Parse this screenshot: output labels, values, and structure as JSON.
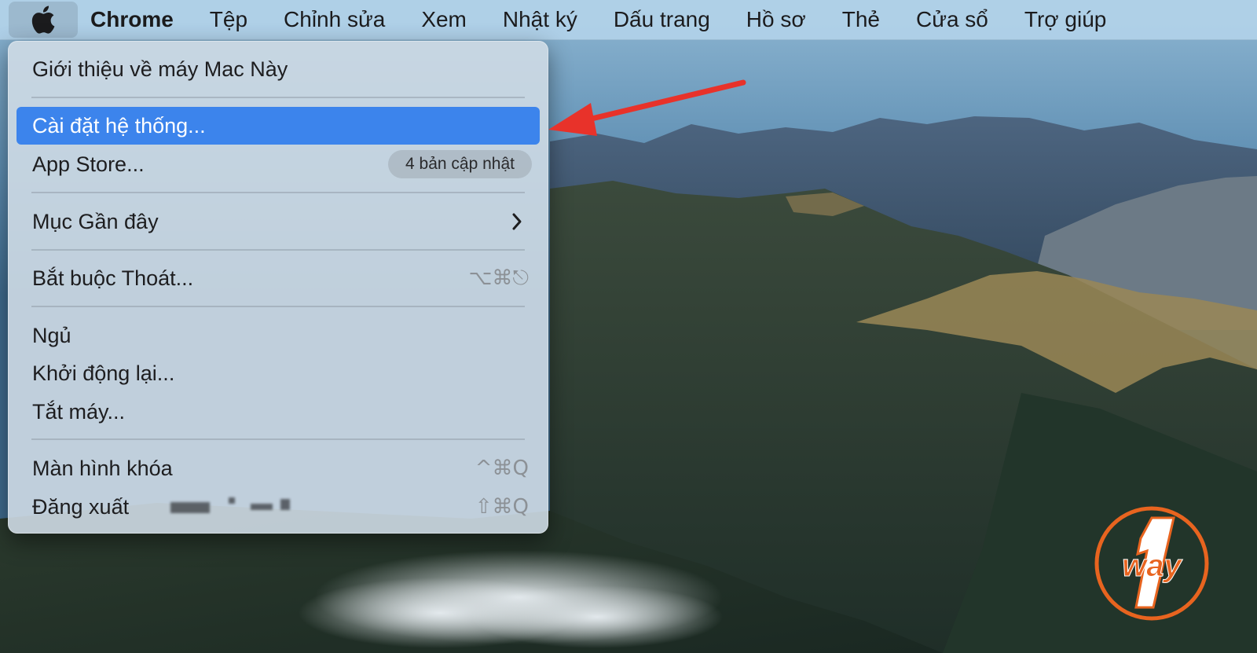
{
  "menubar": {
    "app_name": "Chrome",
    "items": [
      "Tệp",
      "Chỉnh sửa",
      "Xem",
      "Nhật ký",
      "Dấu trang",
      "Hồ sơ",
      "Thẻ",
      "Cửa sổ",
      "Trợ giúp"
    ]
  },
  "apple_menu": {
    "about": "Giới thiệu về máy Mac Này",
    "system_settings": "Cài đặt hệ thống...",
    "app_store": "App Store...",
    "app_store_badge": "4 bản cập nhật",
    "recent_items": "Mục Gần đây",
    "force_quit": "Bắt buộc Thoát...",
    "force_quit_shortcut": "⌥⌘⎋",
    "sleep": "Ngủ",
    "restart": "Khởi động lại...",
    "shutdown": "Tắt máy...",
    "lock_screen": "Màn hình khóa",
    "lock_screen_shortcut": "^⌘Q",
    "log_out": "Đăng xuất",
    "log_out_shortcut": "⇧⌘Q"
  },
  "colors": {
    "highlight": "#3c84ec",
    "arrow": "#e8322a",
    "logo": "#e8641f"
  },
  "watermark": {
    "text": "way",
    "number": "1"
  }
}
